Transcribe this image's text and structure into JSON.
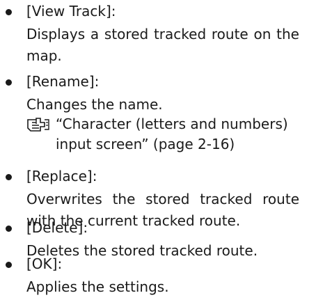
{
  "items": [
    {
      "label": "[View Track]:",
      "description": "Displays a stored tracked route on the map."
    },
    {
      "label": "[Rename]:",
      "description": "Changes the name.",
      "reference": {
        "icon": "pointing-hand-book-icon",
        "text": "“Character (letters and numbers) input screen” (page 2-16)"
      }
    },
    {
      "label": "[Replace]:",
      "description": "Overwrites the stored tracked route with the current tracked route."
    },
    {
      "label": "[Delete]:",
      "description": "Deletes the stored tracked route."
    },
    {
      "label": "[OK]:",
      "description": "Applies the settings."
    }
  ]
}
